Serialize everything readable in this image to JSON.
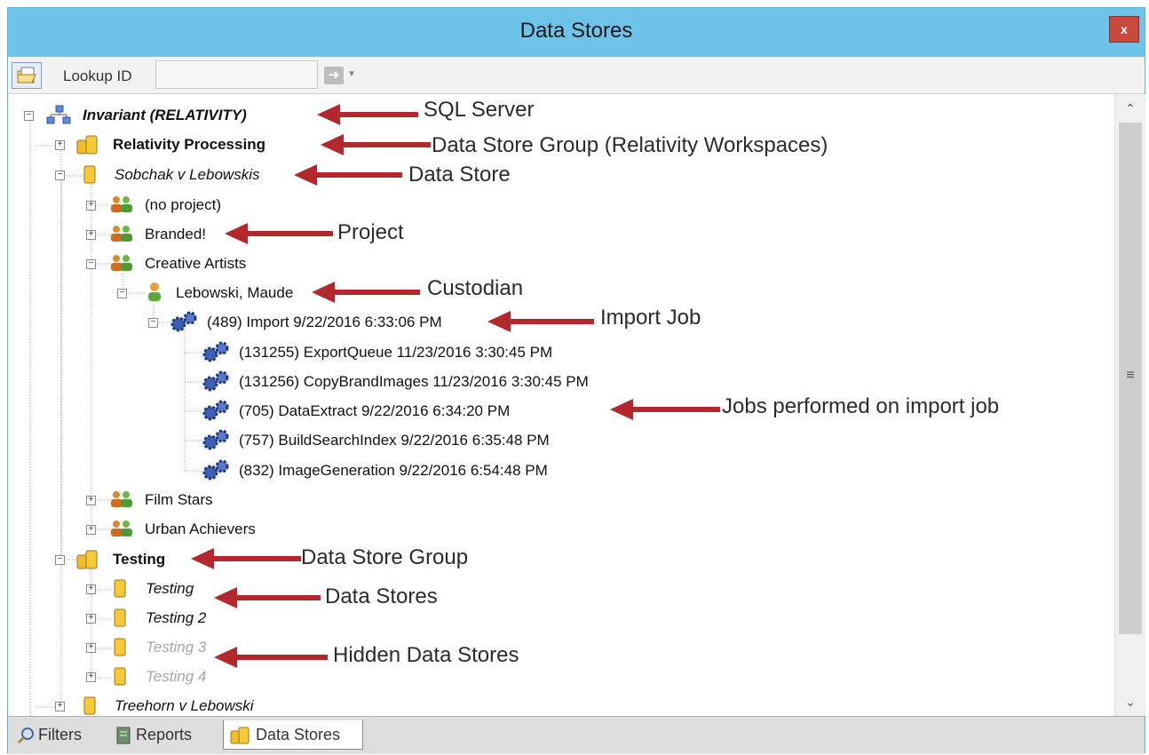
{
  "window": {
    "title": "Data Stores",
    "close_label": "x"
  },
  "toolbar": {
    "lookup_label": "Lookup ID",
    "lookup_value": "",
    "go_icon": "arrow-right-icon"
  },
  "tree": {
    "server": "Invariant (RELATIVITY)",
    "group_processing": "Relativity Processing",
    "store_sobchak": "Sobchak v Lebowskis",
    "project_none": "(no project)",
    "project_branded": "Branded!",
    "project_creative": "Creative Artists",
    "custodian": "Lebowski, Maude",
    "import_job": "(489) Import 9/22/2016 6:33:06 PM",
    "jobs": [
      "(131255) ExportQueue 11/23/2016 3:30:45 PM",
      "(131256) CopyBrandImages 11/23/2016 3:30:45 PM",
      "(705) DataExtract 9/22/2016 6:34:20 PM",
      "(757) BuildSearchIndex 9/22/2016 6:35:48 PM",
      "(832) ImageGeneration 9/22/2016 6:54:48 PM"
    ],
    "project_film": "Film Stars",
    "project_urban": "Urban Achievers",
    "group_testing": "Testing",
    "stores": [
      "Testing",
      "Testing 2",
      "Testing 3",
      "Testing 4"
    ],
    "store_treehorn": "Treehorn v Lebowski"
  },
  "annotations": {
    "sql_server": "SQL Server",
    "group_workspaces": "Data Store Group (Relativity Workspaces)",
    "data_store": "Data Store",
    "project": "Project",
    "custodian": "Custodian",
    "import_job": "Import Job",
    "jobs": "Jobs performed on import job",
    "group": "Data Store Group",
    "stores": "Data Stores",
    "hidden": "Hidden Data Stores"
  },
  "tabs": [
    {
      "label": "Filters",
      "icon": "magnifier-icon"
    },
    {
      "label": "Reports",
      "icon": "report-icon"
    },
    {
      "label": "Data Stores",
      "icon": "database-icon"
    }
  ],
  "colors": {
    "titlebar": "#6dc4e8",
    "close": "#c94a3d",
    "arrow": "#b3282d",
    "hidden_text": "#a6a6a6"
  }
}
